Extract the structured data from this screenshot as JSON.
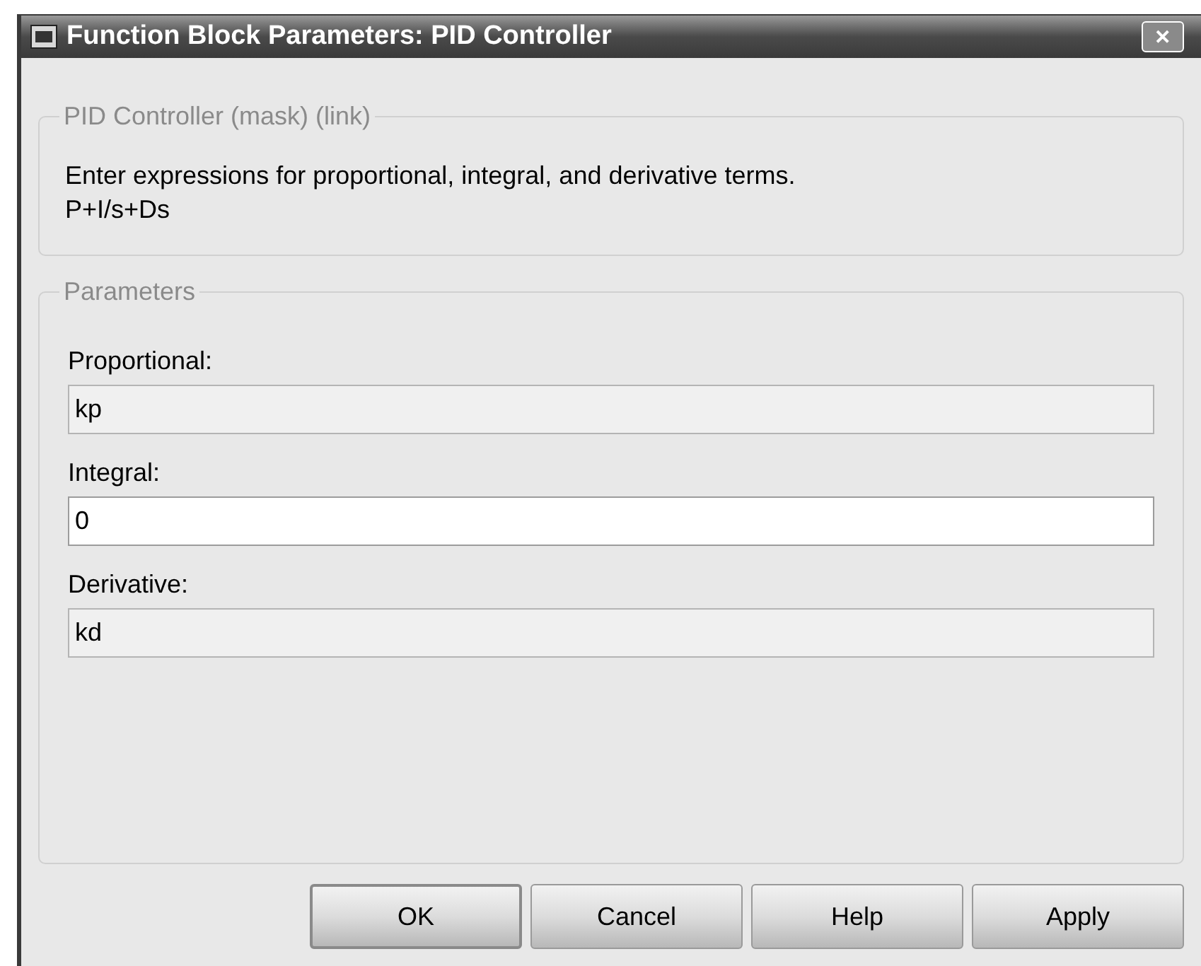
{
  "window": {
    "title": "Function Block Parameters: PID Controller",
    "close": "✕"
  },
  "description_group": {
    "legend": "PID Controller (mask) (link)",
    "lines": [
      "Enter expressions for proportional, integral, and derivative terms.",
      "P+I/s+Ds"
    ]
  },
  "parameters_group": {
    "legend": "Parameters",
    "fields": [
      {
        "label": "Proportional:",
        "value": "kp",
        "focused": false
      },
      {
        "label": "Integral:",
        "value": "0",
        "focused": true
      },
      {
        "label": "Derivative:",
        "value": "kd",
        "focused": false
      }
    ]
  },
  "buttons": [
    {
      "label": "OK",
      "default": true
    },
    {
      "label": "Cancel",
      "default": false
    },
    {
      "label": "Help",
      "default": false
    },
    {
      "label": "Apply",
      "default": false
    }
  ]
}
